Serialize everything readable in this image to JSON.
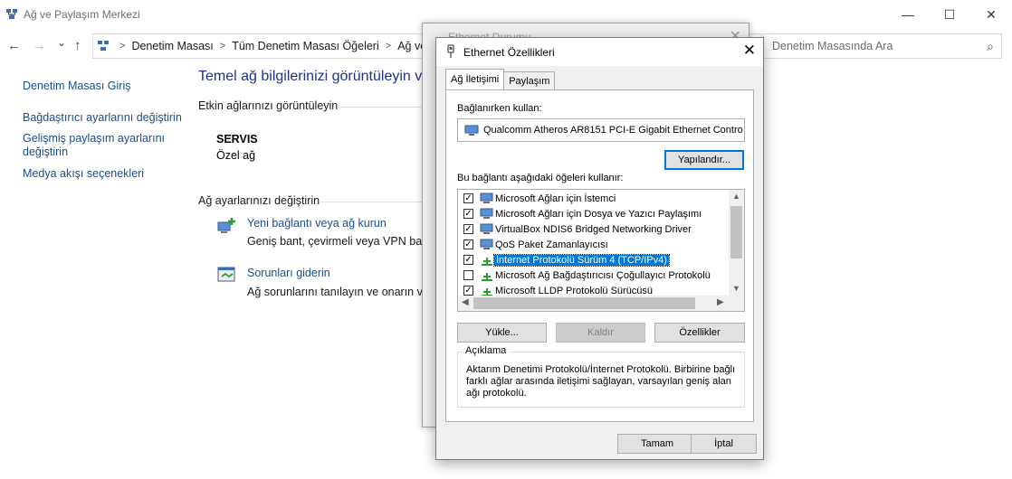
{
  "window": {
    "title": "Ağ ve Paylaşım Merkezi",
    "minimize": "—",
    "maximize": "☐",
    "close": "✕"
  },
  "nav": {
    "back": "←",
    "forward": "→",
    "recent": "⌄",
    "up": "↑"
  },
  "address": {
    "crumbs": [
      "Denetim Masası",
      "Tüm Denetim Masası Öğeleri",
      "Ağ ve Pa"
    ],
    "sep": ">"
  },
  "search": {
    "placeholder": "Denetim Masasında Ara",
    "icon": "⌕"
  },
  "left_nav": {
    "items": [
      "Denetim Masası Giriş",
      "Bağdaştırıcı ayarlarını değiştirin",
      "Gelişmiş paylaşım ayarlarını değiştirin",
      "Medya akışı seçenekleri"
    ]
  },
  "main": {
    "heading": "Temel ağ bilgilerinizi görüntüleyin v",
    "active_networks_label": "Etkin ağlarınızı görüntüleyin",
    "network_name": "SERVIS",
    "network_type": "Özel ağ",
    "change_settings_label": "Ağ ayarlarınızı değiştirin",
    "tasks": [
      {
        "link": "Yeni bağlantı veya ağ kurun",
        "desc": "Geniş bant, çevirmeli veya VPN bağla"
      },
      {
        "link": "Sorunları giderin",
        "desc": "Ağ sorunlarını tanılayın ve onarın vey"
      }
    ]
  },
  "status_window": {
    "title": "Ethernet Durumu",
    "close": "✕"
  },
  "dialog": {
    "title": "Ethernet Özellikleri",
    "close": "✕",
    "tabs": [
      "Ağ İletişimi",
      "Paylaşım"
    ],
    "connect_using_label": "Bağlanırken kullan:",
    "adapter": "Qualcomm Atheros AR8151 PCI-E Gigabit Ethernet Contro",
    "configure_button": "Yapılandır...",
    "items_label": "Bu bağlantı aşağıdaki öğeleri kullanır:",
    "items": [
      {
        "label": "Microsoft Ağları için İstemci",
        "checked": true,
        "selected": false
      },
      {
        "label": "Microsoft Ağları için Dosya ve Yazıcı Paylaşımı",
        "checked": true,
        "selected": false
      },
      {
        "label": "VirtualBox NDIS6 Bridged Networking Driver",
        "checked": true,
        "selected": false
      },
      {
        "label": "QoS Paket Zamanlayıcısı",
        "checked": true,
        "selected": false
      },
      {
        "label": "İnternet Protokolü Sürüm 4 (TCP/IPv4)",
        "checked": true,
        "selected": true
      },
      {
        "label": "Microsoft Ağ Bağdaştırıcısı Çoğullayıcı Protokolü",
        "checked": false,
        "selected": false
      },
      {
        "label": "Microsoft LLDP Protokolü Sürücüsü",
        "checked": true,
        "selected": false
      }
    ],
    "check_glyph": "✓",
    "install_button": "Yükle...",
    "uninstall_button": "Kaldır",
    "properties_button": "Özellikler",
    "description_legend": "Açıklama",
    "description_text": "Aktarım Denetimi Protokolü/İnternet Protokolü. Birbirine bağlı farklı ağlar arasında iletişimi sağlayan, varsayılan geniş alan ağı protokolü.",
    "ok_button": "Tamam",
    "cancel_button": "İptal",
    "scroll_up": "▲",
    "scroll_down": "▼",
    "scroll_left": "◀",
    "scroll_right": "▶"
  }
}
